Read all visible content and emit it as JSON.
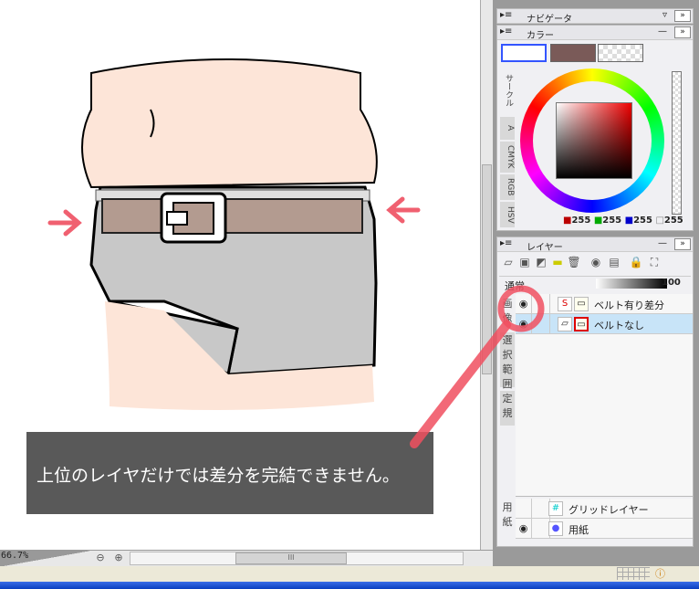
{
  "canvas": {
    "caption": "上位のレイヤだけでは差分を完結できません。",
    "zoom": "66.7%"
  },
  "navigator": {
    "title": "ナビゲータ"
  },
  "color": {
    "title": "カラー",
    "main_color": "#ffffff",
    "sub_color": "#7a5a58",
    "tabs": [
      "サークル",
      "A",
      "CMYK",
      "RGB",
      "HSV"
    ],
    "values": {
      "r": "255",
      "g": "255",
      "b": "255",
      "a": "255"
    }
  },
  "layers": {
    "title": "レイヤー",
    "blend_mode": "通常",
    "opacity": "100",
    "side_tabs": [
      "画像",
      "選択範囲",
      "定規",
      "用紙"
    ],
    "items": [
      {
        "name": "ベルト有り差分",
        "visible": true,
        "selected": false
      },
      {
        "name": "ベルトなし",
        "visible": true,
        "selected": true
      }
    ],
    "paper_items": [
      {
        "name": "グリッドレイヤー",
        "visible": false
      },
      {
        "name": "用紙",
        "visible": true
      }
    ]
  }
}
